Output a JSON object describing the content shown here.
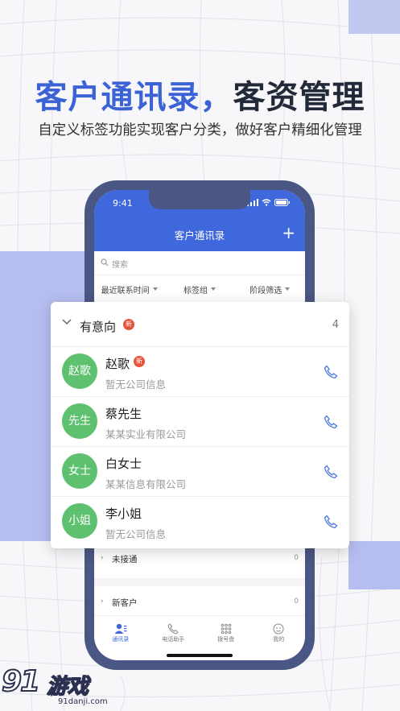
{
  "headline": {
    "part1": "客户通讯录，",
    "part2": "客资管理"
  },
  "subheadline": "自定义标签功能实现客户分类，做好客户精细化管理",
  "colors": {
    "brand_blue": "#3e68dc",
    "avatar_green": "#5ec16f",
    "badge_red": "#e8523a",
    "phone_frame": "#4a5683"
  },
  "phone": {
    "status": {
      "time": "9:41"
    },
    "nav": {
      "title": "客户通讯录",
      "add_icon": "plus-icon"
    },
    "search": {
      "placeholder": "搜索"
    },
    "filters": [
      {
        "label": "最近联系时间"
      },
      {
        "label": "标签组"
      },
      {
        "label": "阶段筛选"
      }
    ],
    "groups": [
      {
        "label": "未接通",
        "count": "0"
      },
      {
        "label": "新客户",
        "count": "0"
      }
    ],
    "tabs": [
      {
        "label": "通讯录",
        "icon": "contacts-icon"
      },
      {
        "label": "电话助手",
        "icon": "phone-assistant-icon"
      },
      {
        "label": "拨号盘",
        "icon": "dialpad-icon"
      },
      {
        "label": "我的",
        "icon": "profile-icon"
      }
    ]
  },
  "card": {
    "group_title": "有意向",
    "new_badge": "新",
    "count": "4",
    "contacts": [
      {
        "avatar": "赵歌",
        "name": "赵歌",
        "badge": "新",
        "company": "暂无公司信息"
      },
      {
        "avatar": "先生",
        "name": "蔡先生",
        "badge": "",
        "company": "某某实业有限公司"
      },
      {
        "avatar": "女士",
        "name": "白女士",
        "badge": "",
        "company": "某某信息有限公司"
      },
      {
        "avatar": "小姐",
        "name": "李小姐",
        "badge": "",
        "company": "暂无公司信息"
      }
    ]
  },
  "watermark": {
    "logo_num": "91",
    "logo_text": "游戏",
    "url": "91danji.com"
  }
}
